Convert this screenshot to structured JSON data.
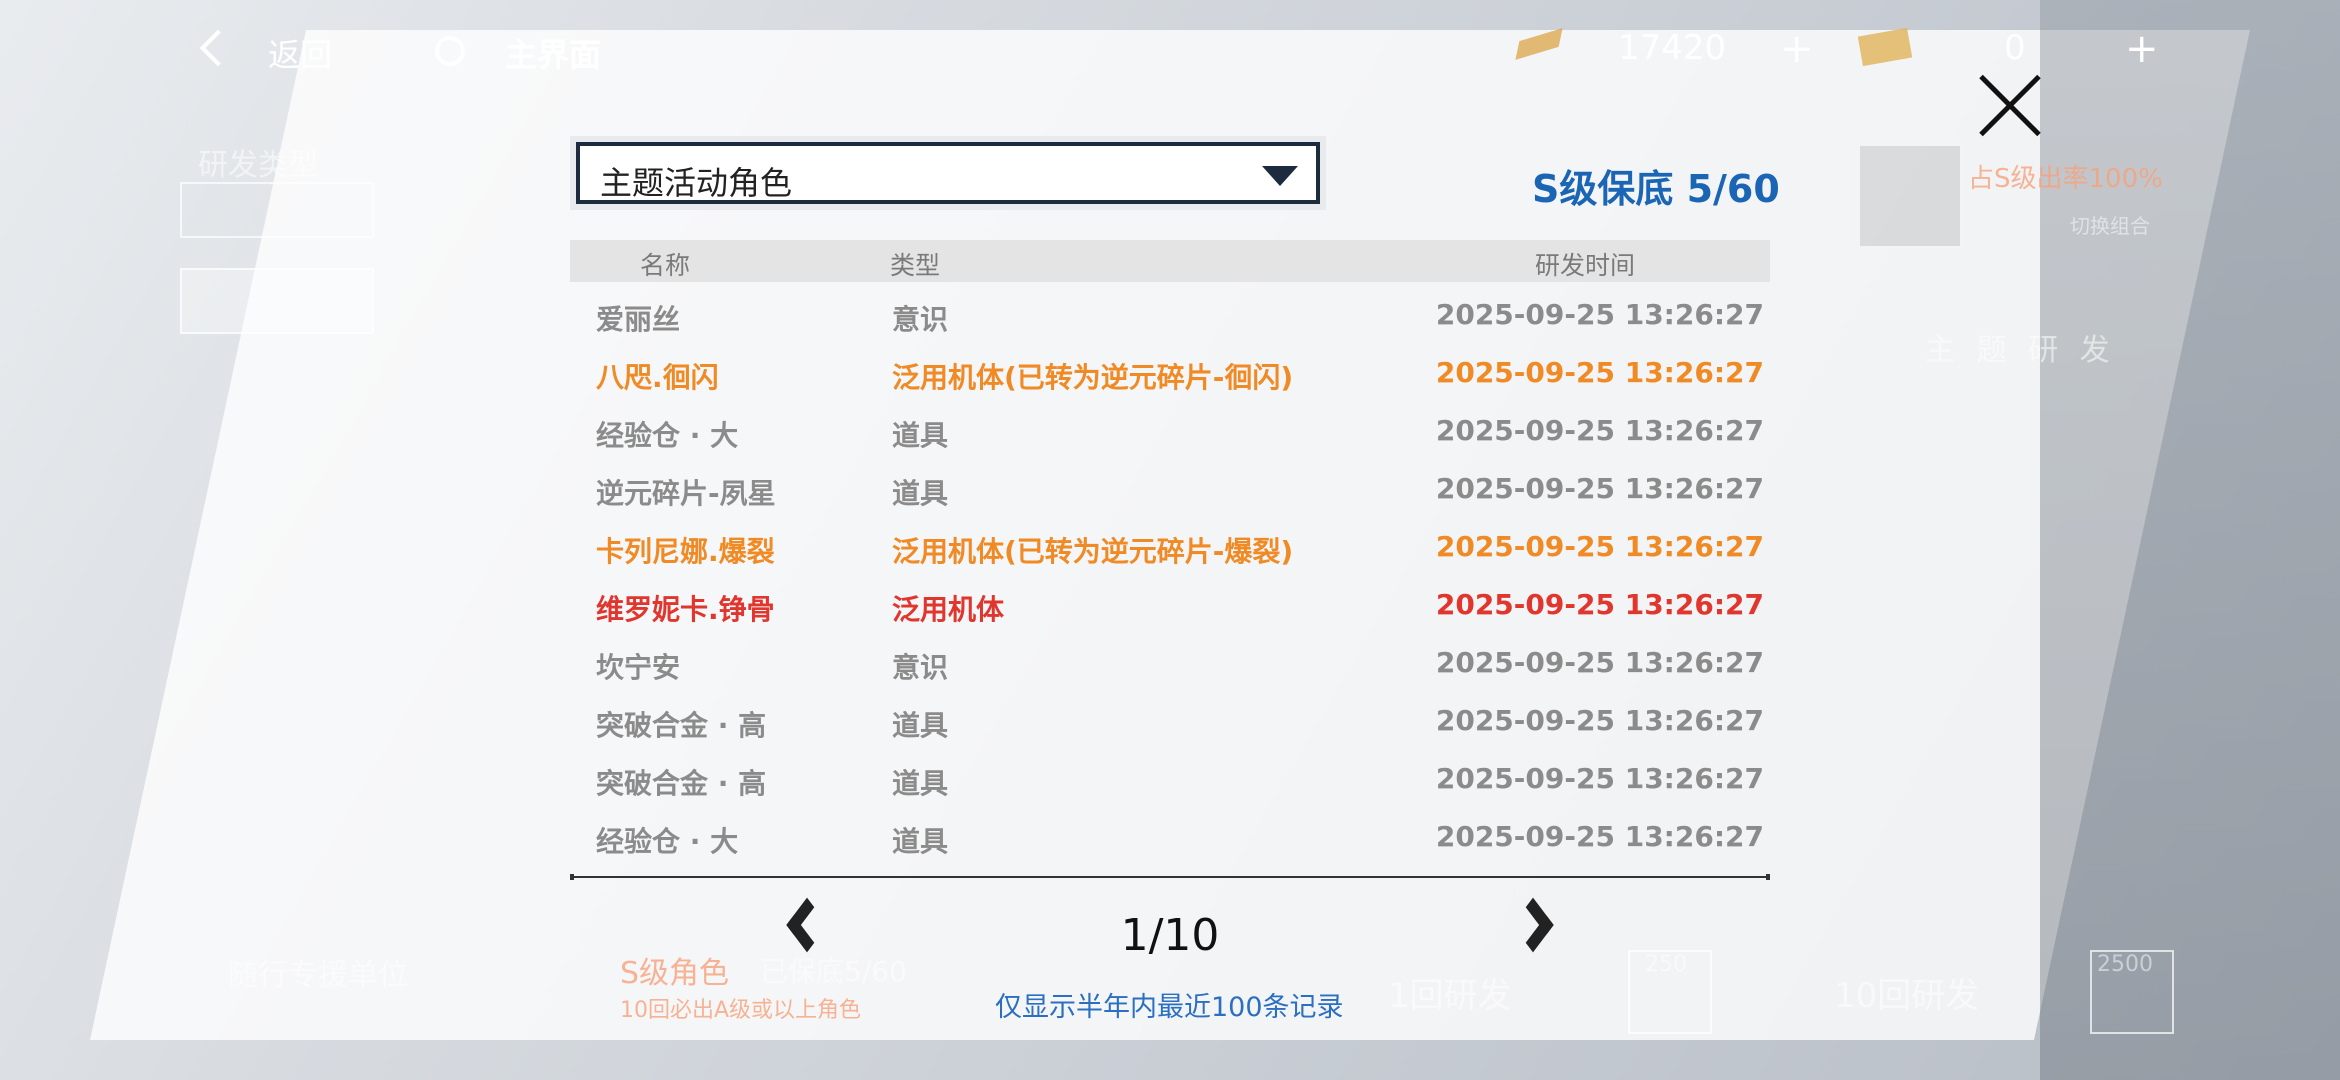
{
  "topbar": {
    "back_label": "返回",
    "home_label": "主界面",
    "resource1_value": "17420",
    "resource2_value": "0",
    "plus": "+"
  },
  "background": {
    "rd_type_label": "研发类型",
    "research_label": "主 题 研 发",
    "support_label": "随行专援单位",
    "s_role_label": "S级角色",
    "guarantee_text": "已保底5/60",
    "ten_pull_hint": "10回必出A级或以上角色",
    "single_pull": "1回研发",
    "ten_pull": "10回研发",
    "cost_single": "250",
    "cost_ten": "2500",
    "rate_text": "占S级出率100%",
    "switch_combo": "切换组合"
  },
  "dialog": {
    "pool_select": "主题活动角色",
    "pity_text": "S级保底 5/60",
    "headers": {
      "name": "名称",
      "type": "类型",
      "time": "研发时间"
    },
    "rows": [
      {
        "name": "爱丽丝",
        "type": "意识",
        "time": "2025-09-25 13:26:27"
      },
      {
        "name": "八咫.徊闪",
        "type": "泛用机体(已转为逆元碎片-徊闪)",
        "time": "2025-09-25 13:26:27"
      },
      {
        "name": "经验仓 · 大",
        "type": "道具",
        "time": "2025-09-25 13:26:27"
      },
      {
        "name": "逆元碎片-夙星",
        "type": "道具",
        "time": "2025-09-25 13:26:27"
      },
      {
        "name": "卡列尼娜.爆裂",
        "type": "泛用机体(已转为逆元碎片-爆裂)",
        "time": "2025-09-25 13:26:27"
      },
      {
        "name": "维罗妮卡.铮骨",
        "type": "泛用机体",
        "time": "2025-09-25 13:26:27"
      },
      {
        "name": "坎宁安",
        "type": "意识",
        "time": "2025-09-25 13:26:27"
      },
      {
        "name": "突破合金 · 高",
        "type": "道具",
        "time": "2025-09-25 13:26:27"
      },
      {
        "name": "突破合金 · 高",
        "type": "道具",
        "time": "2025-09-25 13:26:27"
      },
      {
        "name": "经验仓 · 大",
        "type": "道具",
        "time": "2025-09-25 13:26:27"
      }
    ],
    "page": "1/10",
    "note": "仅显示半年内最近100条记录"
  },
  "colors": {
    "pity_blue": "#1b65b5",
    "orange": "#f08a24",
    "red": "#e0362e",
    "grey": "#8b8b8b"
  }
}
